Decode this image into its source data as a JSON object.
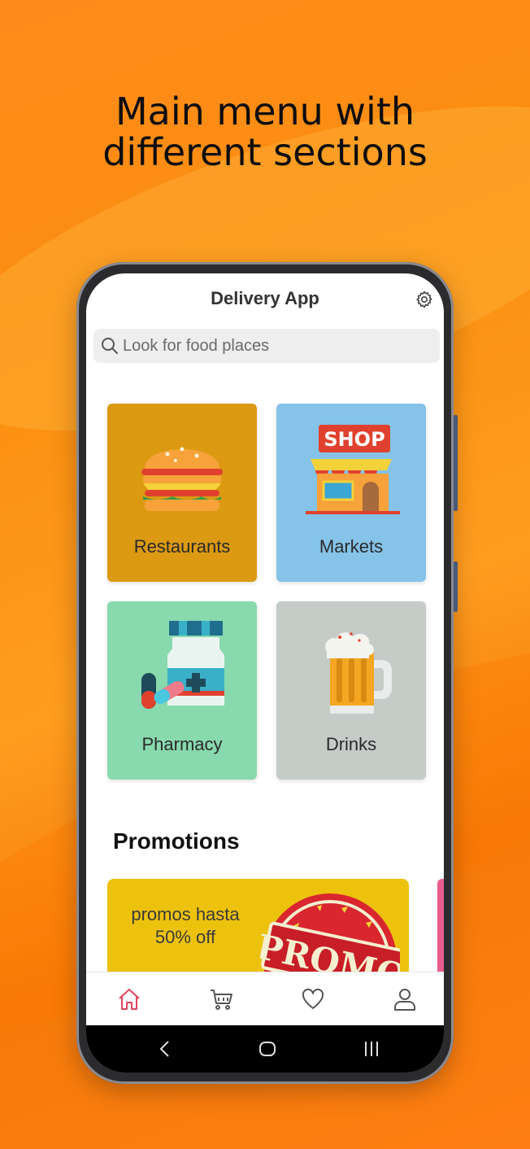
{
  "headline": {
    "line1": "Main menu with",
    "line2": "different sections"
  },
  "app": {
    "title": "Delivery App",
    "settings_icon": "gear-icon"
  },
  "search": {
    "placeholder": "Look for food places",
    "icon": "search-icon"
  },
  "categories": [
    {
      "label": "Restaurants",
      "icon": "burger-icon",
      "color": "#dc9a13"
    },
    {
      "label": "Markets",
      "icon": "shop-icon",
      "color": "#85c3e8"
    },
    {
      "label": "Pharmacy",
      "icon": "medicine-icon",
      "color": "#88d9ad"
    },
    {
      "label": "Drinks",
      "icon": "beer-icon",
      "color": "#c5ccc8"
    }
  ],
  "promotions": {
    "title": "Promotions",
    "card": {
      "line1": "promos hasta",
      "line2": "50% off",
      "stamp_text": "PROMO",
      "color": "#edc20d"
    }
  },
  "bottom_nav": [
    {
      "icon": "home-icon",
      "active": true
    },
    {
      "icon": "cart-icon",
      "active": false
    },
    {
      "icon": "heart-icon",
      "active": false
    },
    {
      "icon": "user-icon",
      "active": false
    }
  ],
  "colors": {
    "accent": "#e0455c",
    "background": "#ff8a1a"
  }
}
